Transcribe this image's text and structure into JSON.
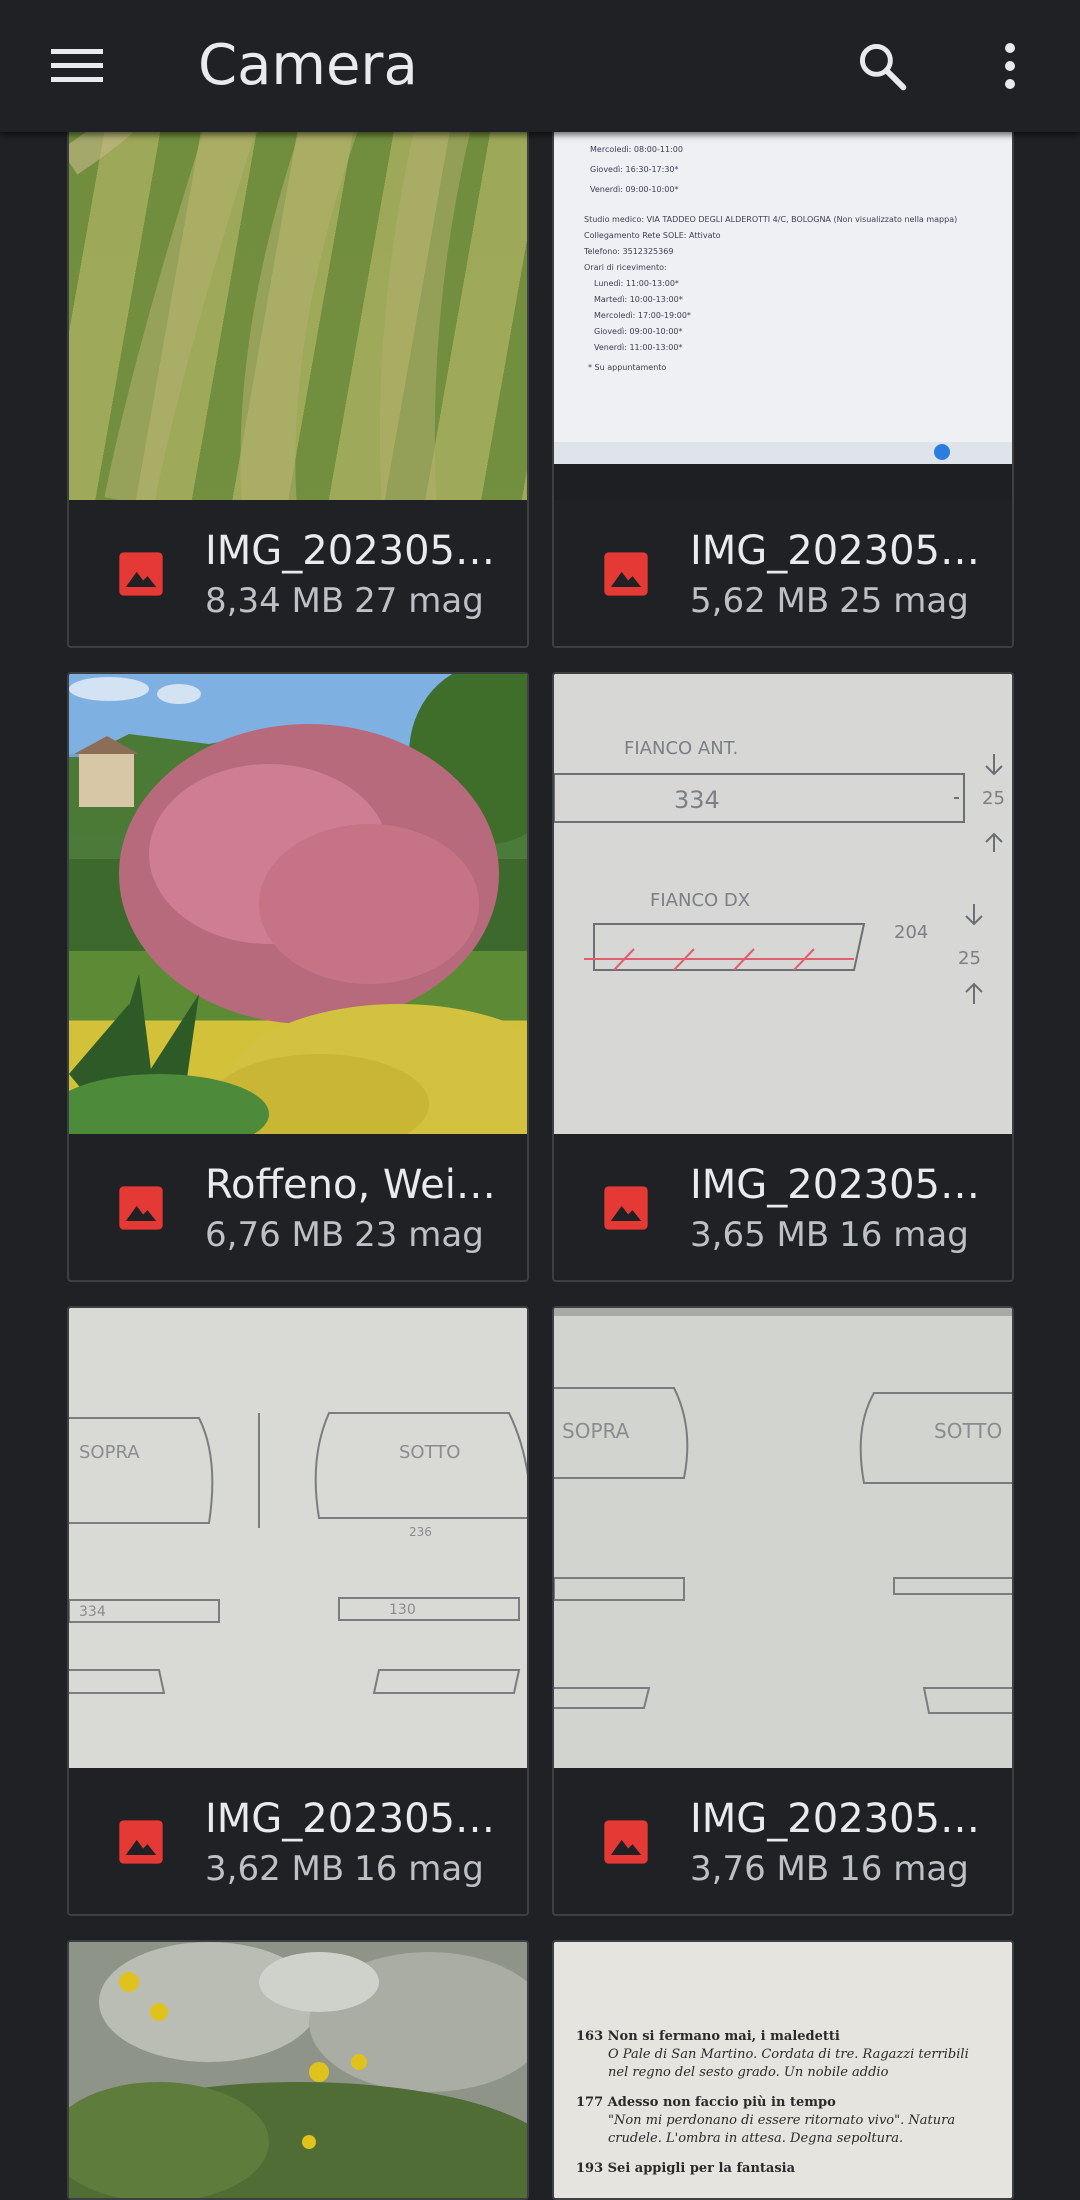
{
  "app_bar": {
    "title": "Camera",
    "menu_icon": "menu-icon",
    "search_icon": "search-icon",
    "more_icon": "more-vert-icon"
  },
  "colors": {
    "background": "#202124",
    "image_icon": "#e53935",
    "text_primary": "#e8eaed",
    "text_secondary": "#bdc1c6"
  },
  "files": [
    {
      "name": "IMG_202305…",
      "size": "8,34 MB",
      "date": "27 mag",
      "icon": "image-icon"
    },
    {
      "name": "IMG_202305…",
      "size": "5,62 MB",
      "date": "25 mag",
      "icon": "image-icon"
    },
    {
      "name": "Roffeno, Wei…",
      "size": "6,76 MB",
      "date": "23 mag",
      "icon": "image-icon"
    },
    {
      "name": "IMG_202305…",
      "size": "3,65 MB",
      "date": "16 mag",
      "icon": "image-icon"
    },
    {
      "name": "IMG_202305…",
      "size": "3,62 MB",
      "date": "16 mag",
      "icon": "image-icon"
    },
    {
      "name": "IMG_202305…",
      "size": "3,76 MB",
      "date": "16 mag",
      "icon": "image-icon"
    }
  ],
  "thumbnail_text": {
    "screen_lines": [
      "Mercoledì: 08:00-11:00",
      "Giovedì: 16:30-17:30*",
      "Venerdì: 09:00-10:00*",
      "Studio medico: VIA TADDEO DEGLI ALDEROTTI 4/C, BOLOGNA (Non visualizzato nella mappa)",
      "Collegamento Rete SOLE: Attivato",
      "Telefono: 3512325369",
      "Orari di ricevimento:",
      "Lunedì: 11:00-13:00*",
      "Martedì: 10:00-13:00*",
      "Mercoledì: 17:00-19:00*",
      "Giovedì: 09:00-10:00*",
      "Venerdì: 11:00-13:00*",
      "* Su appuntamento"
    ],
    "drawing1": {
      "fianco_ant": "FIANCO ANT.",
      "v1": "334",
      "m1": "25",
      "fianco_dx": "FIANCO DX",
      "v2": "204",
      "m2": "25"
    },
    "drawing2": {
      "t1": "SOPRA",
      "t2": "SOTTO",
      "v1": "236",
      "v2": "334",
      "v3": "130"
    },
    "drawing3": {
      "t1": "SOPRA",
      "t2": "SOTTO"
    },
    "book_lines": [
      "163  Non si fermano mai, i maledetti",
      "O Pale di San Martino. Cordata di tre. Ragazzi terribili",
      "nel regno del sesto grado. Un nobile addio",
      "177  Adesso non faccio più in tempo",
      "\"Non mi perdonano di essere ritornato vivo\". Natura",
      "crudele. L'ombra in attesa. Degna sepoltura.",
      "193  Sei appigli per la fantasia"
    ]
  }
}
